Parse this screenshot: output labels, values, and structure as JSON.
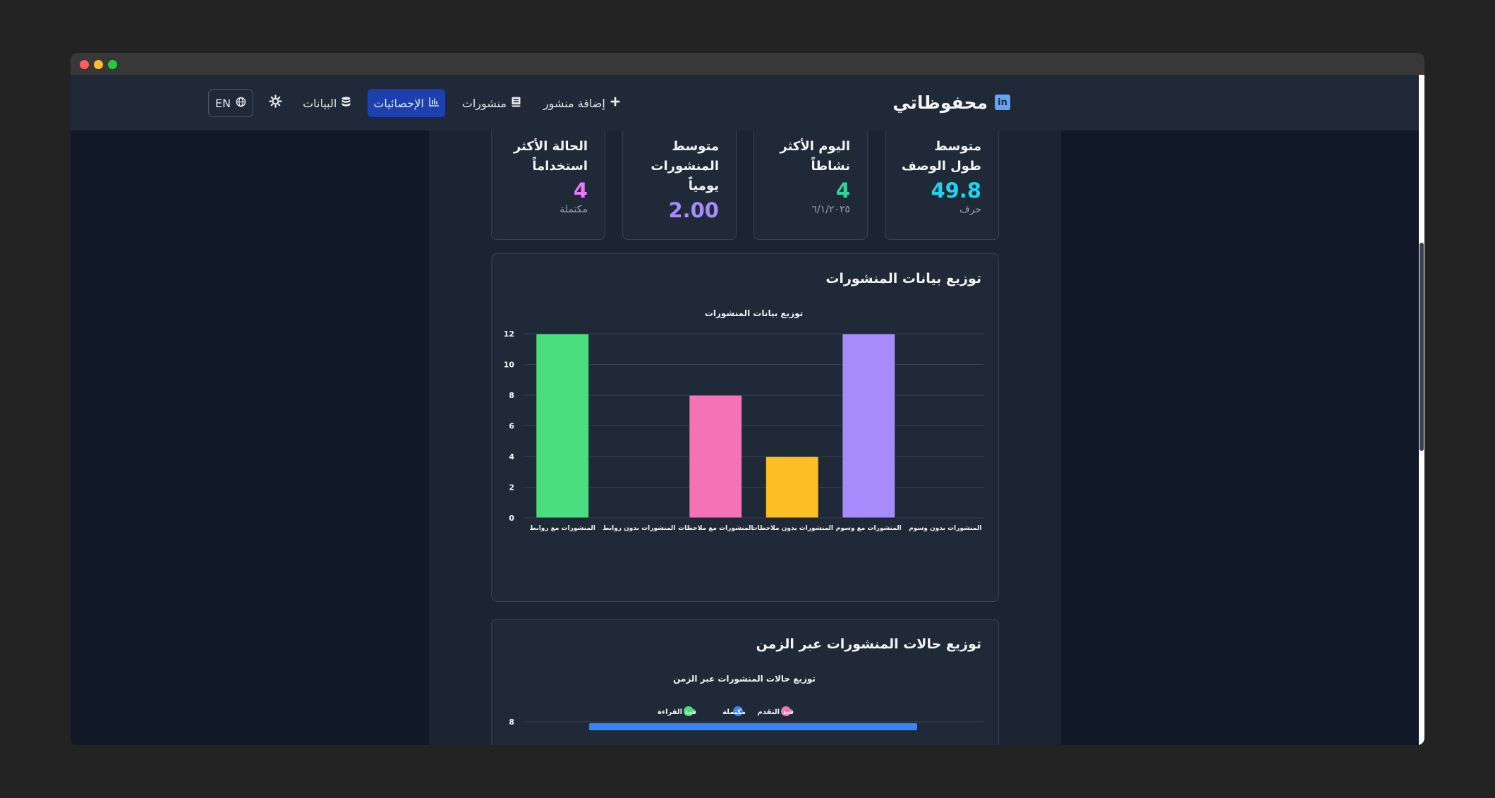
{
  "window": {
    "controls": [
      "close",
      "minimize",
      "maximize"
    ]
  },
  "navbar": {
    "brand": {
      "name": "محفوظاتي",
      "logo_icon": "linkedin-icon",
      "logo_text": "in"
    },
    "items": [
      {
        "label": "إضافة منشور",
        "icon": "plus-icon",
        "active": false
      },
      {
        "label": "منشورات",
        "icon": "book-icon",
        "active": false
      },
      {
        "label": "الإحصائيات",
        "icon": "chart-icon",
        "active": true
      },
      {
        "label": "البيانات",
        "icon": "database-icon",
        "active": false
      }
    ],
    "settings_icon": "gear-icon",
    "language": {
      "label": "EN",
      "icon": "globe-icon"
    }
  },
  "stats": [
    {
      "title": "متوسط طول الوصف",
      "value": "49.8",
      "sub": "حرف",
      "color": "#22d3ee"
    },
    {
      "title": "اليوم الأكثر نشاطاً",
      "value": "4",
      "sub": "٦/١/٢٠٢٥",
      "color": "#34d399"
    },
    {
      "title": "متوسط المنشورات يومياً",
      "value": "2.00",
      "sub": "",
      "color": "#a78bfa"
    },
    {
      "title": "الحالة الأكثر استخداماً",
      "value": "4",
      "sub": "مكتملة",
      "color": "#e879f9"
    }
  ],
  "panels": {
    "distribution": {
      "heading": "توزيع بيانات المنشورات"
    },
    "status_over_time": {
      "heading": "توزيع حالات المنشورات عبر الزمن"
    }
  },
  "chart_data": [
    {
      "type": "bar",
      "title": "توزيع بيانات المنشورات",
      "categories": [
        "المنشورات مع روابط",
        "المنشورات بدون روابط",
        "المنشورات مع ملاحظات",
        "المنشورات بدون ملاحظات",
        "المنشورات مع وسوم",
        "المنشورات بدون وسوم"
      ],
      "values": [
        12,
        0,
        8,
        4,
        12,
        0
      ],
      "colors": [
        "#4ade80",
        "#60a5fa",
        "#f472b6",
        "#fbbf24",
        "#a78bfa",
        "#22d3ee"
      ],
      "ylim": [
        0,
        12
      ],
      "yticks": [
        0,
        2,
        4,
        6,
        8,
        10,
        12
      ],
      "grid": true,
      "legend": "none"
    },
    {
      "type": "bar",
      "title": "توزيع حالات المنشورات عبر الزمن",
      "series": [
        {
          "name": "قيد القراءة",
          "color": "#4ade80"
        },
        {
          "name": "مكتملة",
          "color": "#3b82f6"
        },
        {
          "name": "قيد التقدم",
          "color": "#f472b6"
        }
      ],
      "yticks_visible": [
        8
      ],
      "grid": true,
      "legend": "top-center"
    }
  ]
}
